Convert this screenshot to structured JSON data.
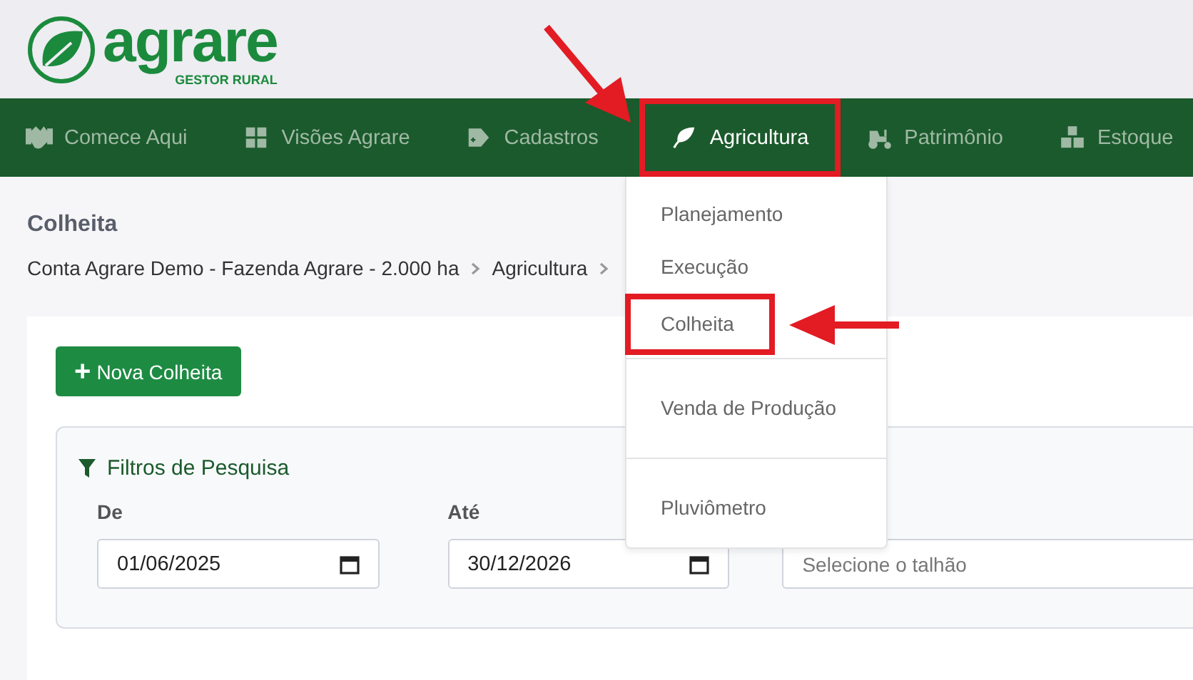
{
  "logo": {
    "name": "agrare",
    "tagline": "GESTOR RURAL"
  },
  "nav": [
    {
      "label": "Comece Aqui",
      "selected": false,
      "highlighted": false
    },
    {
      "label": "Visões Agrare",
      "selected": false,
      "highlighted": false
    },
    {
      "label": "Cadastros",
      "selected": false,
      "highlighted": false
    },
    {
      "label": "Agricultura",
      "selected": true,
      "highlighted": true
    },
    {
      "label": "Patrimônio",
      "selected": false,
      "highlighted": false
    },
    {
      "label": "Estoque",
      "selected": false,
      "highlighted": false
    }
  ],
  "dropdown": {
    "groups": [
      [
        {
          "label": "Planejamento",
          "highlighted": false
        },
        {
          "label": "Execução",
          "highlighted": false
        },
        {
          "label": "Colheita",
          "highlighted": true
        }
      ],
      [
        {
          "label": "Venda de Produção",
          "highlighted": false
        }
      ],
      [
        {
          "label": "Pluviômetro",
          "highlighted": false
        }
      ]
    ]
  },
  "page": {
    "title": "Colheita",
    "breadcrumb": [
      "Conta Agrare Demo - Fazenda Agrare - 2.000 ha",
      "Agricultura"
    ],
    "breadcrumb_continues": true
  },
  "new_button": {
    "icon": "+",
    "label": "Nova Colheita"
  },
  "filters": {
    "title": "Filtros de Pesquisa",
    "fields": [
      {
        "kind": "date",
        "label": "De",
        "value": "01/06/2025"
      },
      {
        "kind": "date",
        "label": "Até",
        "value": "30/12/2026"
      },
      {
        "kind": "select",
        "placeholder": "Selecione o talhão"
      }
    ]
  }
}
